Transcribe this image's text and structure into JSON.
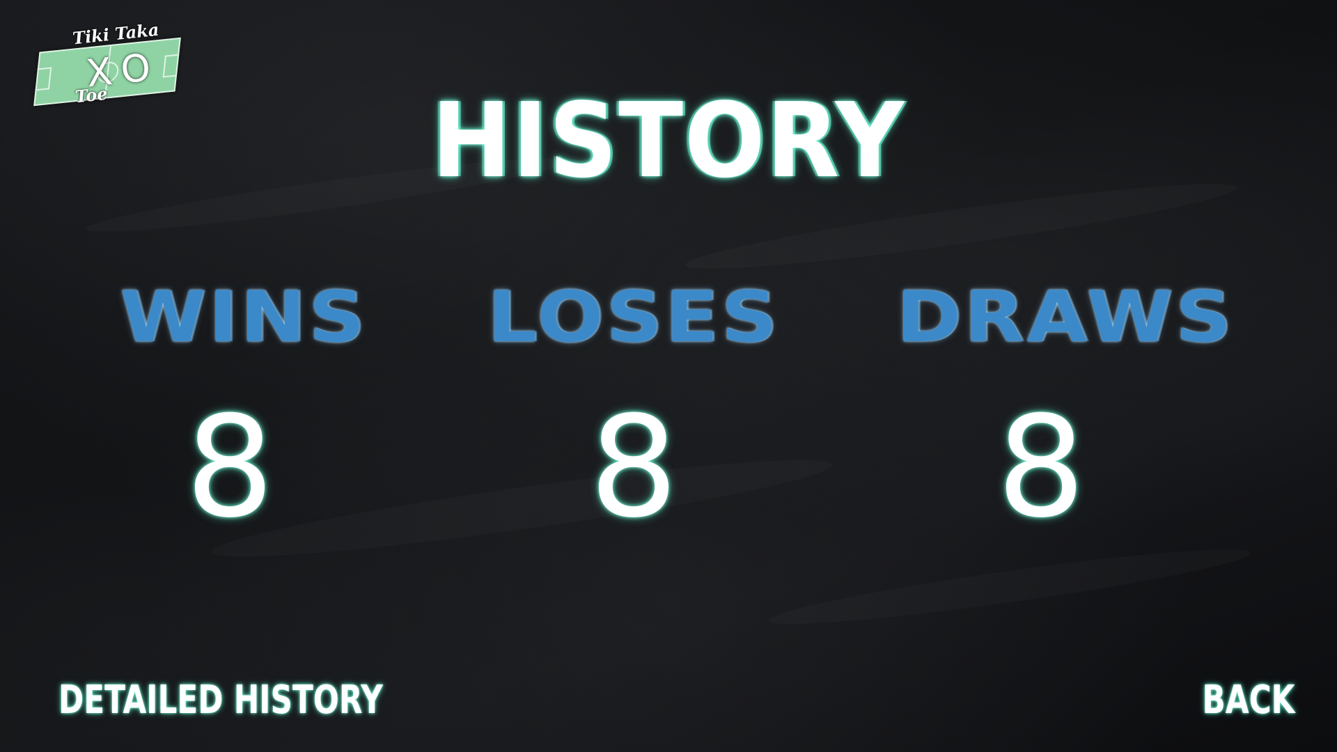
{
  "logo": {
    "line1": "Tiki Taka",
    "mark": "XO",
    "line2": "Toe"
  },
  "header": {
    "title": "HISTORY"
  },
  "stats": [
    {
      "label": "WINS",
      "value": "8"
    },
    {
      "label": "LOSES",
      "value": "8"
    },
    {
      "label": "DRAWS",
      "value": "8"
    }
  ],
  "footer": {
    "detailed_history_label": "DETAILED HISTORY",
    "back_label": "BACK"
  },
  "colors": {
    "background": "#101113",
    "title_text": "#ffffff",
    "title_glow": "#7fffe0",
    "stat_label": "#3b89c9",
    "logo_pitch": "#8fd3a4"
  }
}
